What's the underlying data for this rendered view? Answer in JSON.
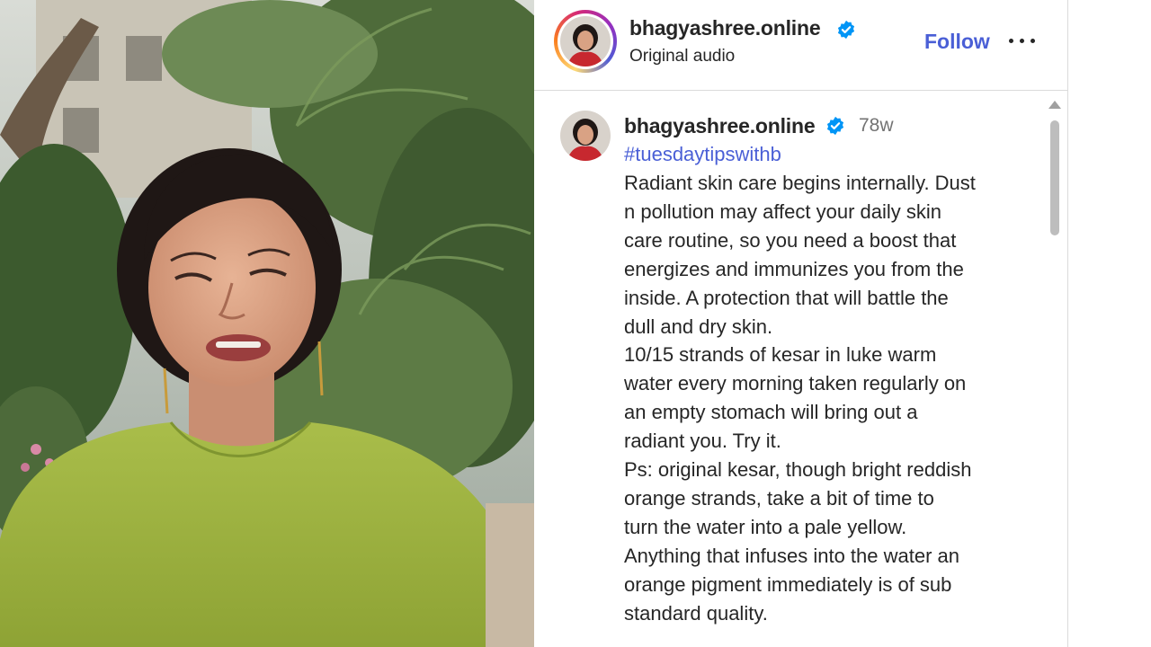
{
  "post": {
    "username": "bhagyashree.online",
    "subtitle": "Original audio",
    "follow_label": "Follow",
    "more_icon": "more-options-icon",
    "verified_icon": "verified-badge-icon"
  },
  "comment": {
    "username": "bhagyashree.online",
    "time": "78w",
    "hashtag": "#tuesdaytipswithb",
    "caption_lines": [
      "Radiant skin care begins internally. Dust",
      "n pollution may affect your daily skin",
      "care routine, so you need a boost that",
      "energizes and immunizes you from the",
      "inside. A protection that will battle the",
      "dull and dry skin.",
      "10/15 strands of kesar in luke warm",
      "water every morning taken regularly on",
      "an empty stomach will bring out a",
      "radiant you. Try it.",
      "Ps: original kesar, though bright reddish",
      "orange strands, take a bit of time to",
      "turn the water into a pale yellow.",
      "Anything that infuses into the water an",
      "orange pigment immediately is of sub",
      "standard quality."
    ]
  },
  "colors": {
    "link_blue": "#4a5fd6",
    "verified_blue": "#0095f6",
    "text": "#262626",
    "muted": "#737373"
  }
}
